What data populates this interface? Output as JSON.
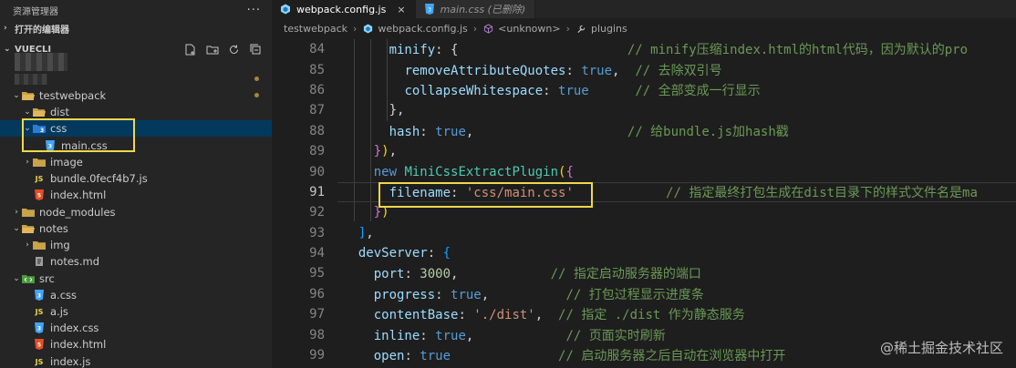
{
  "sidebar": {
    "title": "资源管理器",
    "more_icon": "ellipsis-icon",
    "open_editors_label": "打开的编辑器",
    "root_label": "VUECLI",
    "tools": [
      "new-file-icon",
      "new-folder-icon",
      "refresh-icon",
      "collapse-all-icon"
    ],
    "tree": [
      {
        "label": "testwebpack",
        "icon": "folder-open",
        "chev": "⌄"
      },
      {
        "label": "dist",
        "icon": "folder-open",
        "chev": "⌄"
      },
      {
        "label": "css",
        "icon": "folder-css",
        "chev": "⌄"
      },
      {
        "label": "main.css",
        "icon": "css-file",
        "chev": ""
      },
      {
        "label": "image",
        "icon": "folder-closed",
        "chev": "›"
      },
      {
        "label": "bundle.0fecf4b7.js",
        "icon": "js-file",
        "chev": ""
      },
      {
        "label": "index.html",
        "icon": "html-file",
        "chev": ""
      },
      {
        "label": "node_modules",
        "icon": "folder-closed",
        "chev": "›"
      },
      {
        "label": "notes",
        "icon": "folder-open",
        "chev": "⌄"
      },
      {
        "label": "img",
        "icon": "folder-closed",
        "chev": "›"
      },
      {
        "label": "notes.md",
        "icon": "md-file",
        "chev": ""
      },
      {
        "label": "src",
        "icon": "folder-src",
        "chev": "⌄"
      },
      {
        "label": "a.css",
        "icon": "css-file",
        "chev": ""
      },
      {
        "label": "a.js",
        "icon": "js-file",
        "chev": ""
      },
      {
        "label": "index.css",
        "icon": "css-file",
        "chev": ""
      },
      {
        "label": "index.html",
        "icon": "html-file",
        "chev": ""
      },
      {
        "label": "index.js",
        "icon": "js-file",
        "chev": ""
      }
    ]
  },
  "tabs": [
    {
      "label": "webpack.config.js",
      "icon": "webpack-icon",
      "active": true,
      "close": "×"
    },
    {
      "label": "main.css (已删除)",
      "icon": "css-file",
      "active": false
    }
  ],
  "breadcrumbs": [
    "testwebpack",
    "webpack.config.js",
    "<unknown>",
    "plugins"
  ],
  "code": [
    {
      "n": "84",
      "html": "      <span class=\"prop\">minify</span>: {                      <span class=\"cmt\">// minify压缩index.html的html代码，因为默认的pro</span>"
    },
    {
      "n": "85",
      "html": "        <span class=\"prop\">removeAttributeQuotes</span>: <span class=\"bool\">true</span>,  <span class=\"cmt\">// 去除双引号</span>"
    },
    {
      "n": "86",
      "html": "        <span class=\"prop\">collapseWhitespace</span>: <span class=\"bool\">true</span>      <span class=\"cmt\">// 全部变成一行显示</span>"
    },
    {
      "n": "87",
      "html": "      },"
    },
    {
      "n": "88",
      "html": "      <span class=\"prop\">hash</span>: <span class=\"bool\">true</span>,                    <span class=\"cmt\">// 给bundle.js加hash戳</span>"
    },
    {
      "n": "89",
      "html": "    <span class=\"b2\">}</span><span class=\"b1\">)</span>,"
    },
    {
      "n": "90",
      "html": "    <span class=\"kw\">new</span> <span class=\"cls\">MiniCssExtractPlugin</span><span class=\"b1\">(</span><span class=\"b2\">{</span>"
    },
    {
      "n": "91",
      "html": "      <span class=\"prop\">filename</span>: <span class=\"str\">'css/main.css'</span>            <span class=\"cmt\">// 指定最终打包生成在dist目录下的样式文件名是ma</span>",
      "current": true
    },
    {
      "n": "92",
      "html": "    <span class=\"b2\">}</span><span class=\"b1\">)</span>"
    },
    {
      "n": "93",
      "html": "  <span class=\"b3\">]</span>,"
    },
    {
      "n": "94",
      "html": "  <span class=\"prop\">devServer</span>: <span class=\"b3\">{</span>"
    },
    {
      "n": "95",
      "html": "    <span class=\"prop\">port</span>: <span class=\"num\">3000</span>,            <span class=\"cmt\">// 指定启动服务器的端口</span>"
    },
    {
      "n": "96",
      "html": "    <span class=\"prop\">progress</span>: <span class=\"bool\">true</span>,          <span class=\"cmt\">// 打包过程显示进度条</span>"
    },
    {
      "n": "97",
      "html": "    <span class=\"prop\">contentBase</span>: <span class=\"str\">'./dist'</span>,  <span class=\"cmt\">// 指定 ./dist 作为静态服务</span>"
    },
    {
      "n": "98",
      "html": "    <span class=\"prop\">inline</span>: <span class=\"bool\">true</span>,            <span class=\"cmt\">// 页面实时刷新</span>"
    },
    {
      "n": "99",
      "html": "    <span class=\"prop\">open</span>: <span class=\"bool\">true</span>              <span class=\"cmt\">// 启动服务器之后自动在浏览器中打开</span>"
    }
  ],
  "watermark": "@稀土掘金技术社区",
  "colors": {
    "selection": "#04395e",
    "highlight_box": "#f0d84a",
    "folder": "#d9a74a"
  }
}
